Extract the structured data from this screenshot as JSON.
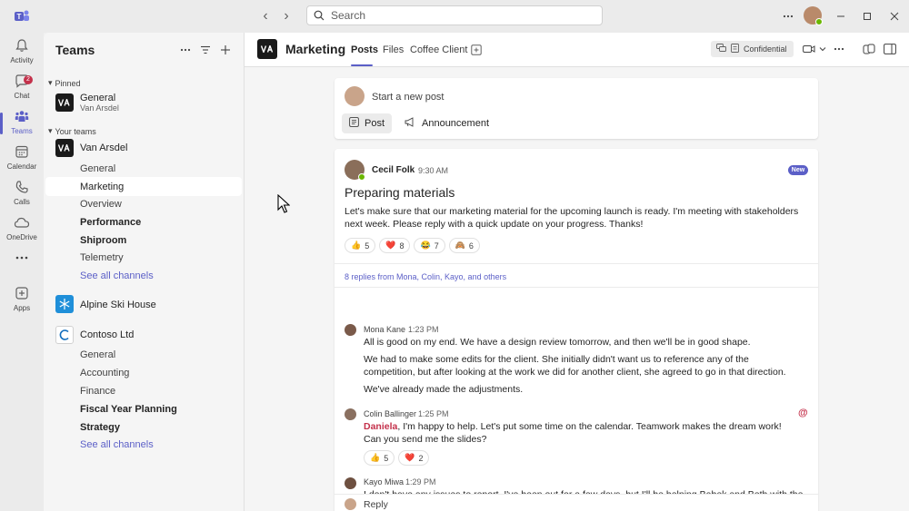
{
  "titlebar": {
    "search_placeholder": "Search",
    "icons": [
      "teams-logo-icon",
      "back-arrow-icon",
      "forward-arrow-icon",
      "search-icon",
      "more-icon",
      "minimize-icon",
      "maximize-icon",
      "close-icon"
    ]
  },
  "rail": {
    "items": [
      {
        "label": "Activity",
        "icon": "bell-icon"
      },
      {
        "label": "Chat",
        "icon": "chat-icon",
        "badge": "2"
      },
      {
        "label": "Teams",
        "icon": "teams-icon",
        "active": true
      },
      {
        "label": "Calendar",
        "icon": "calendar-icon"
      },
      {
        "label": "Calls",
        "icon": "phone-icon"
      },
      {
        "label": "OneDrive",
        "icon": "cloud-icon"
      },
      {
        "label": "",
        "icon": "more-icon"
      },
      {
        "label": "Apps",
        "icon": "apps-icon"
      }
    ]
  },
  "sidebar": {
    "title": "Teams",
    "pinned_label": "Pinned",
    "pinned": {
      "name": "General",
      "sub": "Van Arsdel"
    },
    "your_teams_label": "Your teams",
    "teams": [
      {
        "name": "Van Arsdel",
        "channels": [
          "General",
          "Marketing",
          "Overview",
          "Performance",
          "Shiproom",
          "Telemetry"
        ],
        "see_all": "See all channels"
      },
      {
        "name": "Alpine Ski House"
      },
      {
        "name": "Contoso Ltd",
        "channels": [
          "General",
          "Accounting",
          "Finance",
          "Fiscal Year Planning",
          "Strategy"
        ],
        "see_all": "See all channels"
      }
    ]
  },
  "header": {
    "channel_title": "Marketing",
    "tabs": [
      "Posts",
      "Files",
      "Coffee Client"
    ],
    "active_tab": "Posts",
    "sensitivity": "Confidential"
  },
  "new_post": {
    "prompt": "Start a new post",
    "post_label": "Post",
    "announcement_label": "Announcement"
  },
  "thread": {
    "author": "Cecil Folk",
    "time": "9:30 AM",
    "badge": "New",
    "title": "Preparing materials",
    "body": "Let's make sure that our marketing material for the upcoming launch is ready. I'm meeting with stakeholders next week. Please reply with a quick update on your progress. Thanks!",
    "reactions": [
      {
        "emoji": "👍",
        "count": "5"
      },
      {
        "emoji": "❤️",
        "count": "8"
      },
      {
        "emoji": "😂",
        "count": "7"
      },
      {
        "emoji": "🙈",
        "count": "6"
      }
    ],
    "replies_summary": "8 replies from Mona, Colin, Kayo, and others",
    "replies": [
      {
        "author": "Mona Kane",
        "time": "1:23 PM",
        "paragraphs": [
          "All is good on my end. We have a design review tomorrow, and then we'll be in good shape.",
          "We had to make some edits for the client. She initially didn't want us to reference any of the competition, but after looking at the work we did for another client, she agreed to go in that direction.",
          "We've already made the adjustments."
        ]
      },
      {
        "author": "Colin Ballinger",
        "time": "1:25 PM",
        "mention": "Daniela",
        "text": ", I'm happy to help. Let's put some time on the calendar. Teamwork makes the dream work! Can you send me the slides?",
        "reactions": [
          {
            "emoji": "👍",
            "count": "5"
          },
          {
            "emoji": "❤️",
            "count": "2"
          }
        ]
      },
      {
        "author": "Kayo Miwa",
        "time": "1:29 PM",
        "text": "I don't have any issues to report. I've been out for a few days, but I'll be helping Babek and Beth with the studio production work starting tomorrow."
      }
    ],
    "reply_label": "Reply"
  },
  "colors": {
    "accent": "#5b5fc7",
    "mention": "#c4314b",
    "presence": "#6bb700"
  }
}
